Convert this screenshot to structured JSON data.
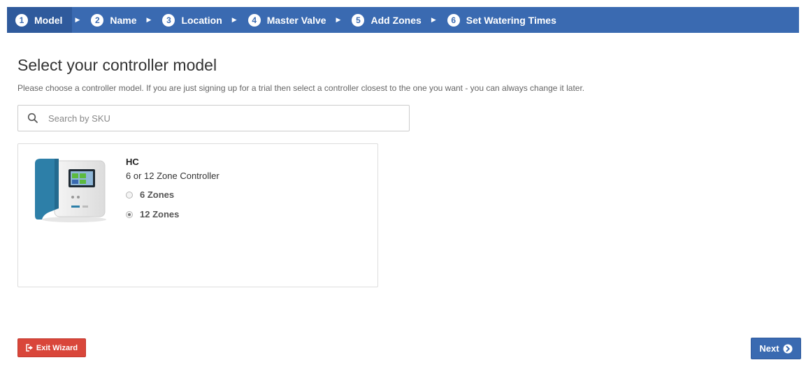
{
  "wizard": {
    "steps": [
      {
        "number": "1",
        "label": "Model"
      },
      {
        "number": "2",
        "label": "Name"
      },
      {
        "number": "3",
        "label": "Location"
      },
      {
        "number": "4",
        "label": "Master Valve"
      },
      {
        "number": "5",
        "label": "Add Zones"
      },
      {
        "number": "6",
        "label": "Set Watering Times"
      }
    ],
    "active_step": "1"
  },
  "page": {
    "title": "Select your controller model",
    "subtitle": "Please choose a controller model. If you are just signing up for a trial then select a controller closest to the one you want - you can always change it later."
  },
  "search": {
    "placeholder": "Search by SKU",
    "value": ""
  },
  "model_card": {
    "name": "HC",
    "description": "6 or 12 Zone Controller",
    "image_icon": "controller-device-image",
    "options": [
      {
        "label": "6 Zones",
        "selected": false
      },
      {
        "label": "12 Zones",
        "selected": true
      }
    ]
  },
  "actions": {
    "exit_label": "Exit Wizard",
    "next_label": "Next"
  },
  "colors": {
    "primary": "#3a6ab1",
    "danger": "#d9463a",
    "device_teal": "#2d7fa8"
  }
}
